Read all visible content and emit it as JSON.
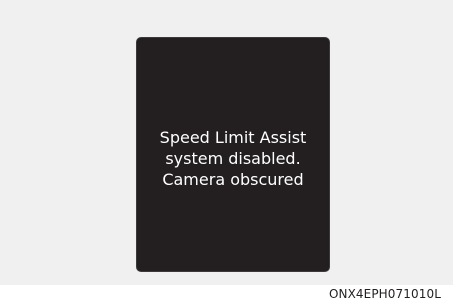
{
  "display": {
    "message_lines": [
      "Speed Limit Assist",
      "system disabled.",
      "Camera obscured"
    ]
  },
  "figure": {
    "reference_code": "ONX4EPH071010L"
  },
  "colors": {
    "background": "#f0f0f0",
    "screen": "#231f20",
    "text": "#ffffff"
  }
}
